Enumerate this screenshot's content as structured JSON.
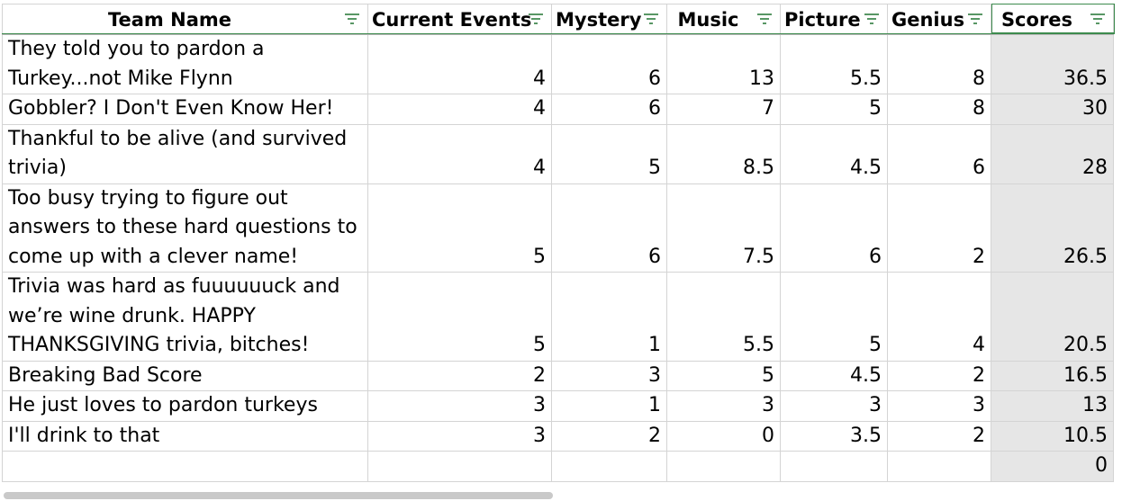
{
  "headers": {
    "team": "Team Name",
    "current_events": "Current Events",
    "mystery": "Mystery",
    "music": "Music",
    "picture": "Picture",
    "genius": "Genius",
    "scores": "Scores"
  },
  "rows": [
    {
      "team": "They told you to pardon a Turkey...not Mike Flynn",
      "current_events": "4",
      "mystery": "6",
      "music": "13",
      "picture": "5.5",
      "genius": "8",
      "scores": "36.5"
    },
    {
      "team": "Gobbler? I Don't Even Know Her!",
      "current_events": "4",
      "mystery": "6",
      "music": "7",
      "picture": "5",
      "genius": "8",
      "scores": "30"
    },
    {
      "team": "Thankful to be alive (and survived trivia)",
      "current_events": "4",
      "mystery": "5",
      "music": "8.5",
      "picture": "4.5",
      "genius": "6",
      "scores": "28"
    },
    {
      "team": "Too busy trying to figure out answers to these hard questions to come up with a clever name!",
      "current_events": "5",
      "mystery": "6",
      "music": "7.5",
      "picture": "6",
      "genius": "2",
      "scores": "26.5"
    },
    {
      "team": "Trivia was hard as fuuuuuuck and we’re wine drunk. HAPPY THANKSGIVING trivia, bitches!",
      "current_events": "5",
      "mystery": "1",
      "music": "5.5",
      "picture": "5",
      "genius": "4",
      "scores": "20.5"
    },
    {
      "team": "Breaking Bad Score",
      "current_events": "2",
      "mystery": "3",
      "music": "5",
      "picture": "4.5",
      "genius": "2",
      "scores": "16.5"
    },
    {
      "team": "He just loves to pardon turkeys",
      "current_events": "3",
      "mystery": "1",
      "music": "3",
      "picture": "3",
      "genius": "3",
      "scores": "13"
    },
    {
      "team": "I'll drink to that",
      "current_events": "3",
      "mystery": "2",
      "music": "0",
      "picture": "3.5",
      "genius": "2",
      "scores": "10.5"
    },
    {
      "team": "",
      "current_events": "",
      "mystery": "",
      "music": "",
      "picture": "",
      "genius": "",
      "scores": "0"
    }
  ],
  "icons": {
    "filter": "filter-icon"
  },
  "colors": {
    "header_border_accent": "#3d8b4e",
    "filter_icon": "#2e7d3e",
    "score_fill": "#e6e6e6",
    "grid_line": "#d4d4d4"
  }
}
